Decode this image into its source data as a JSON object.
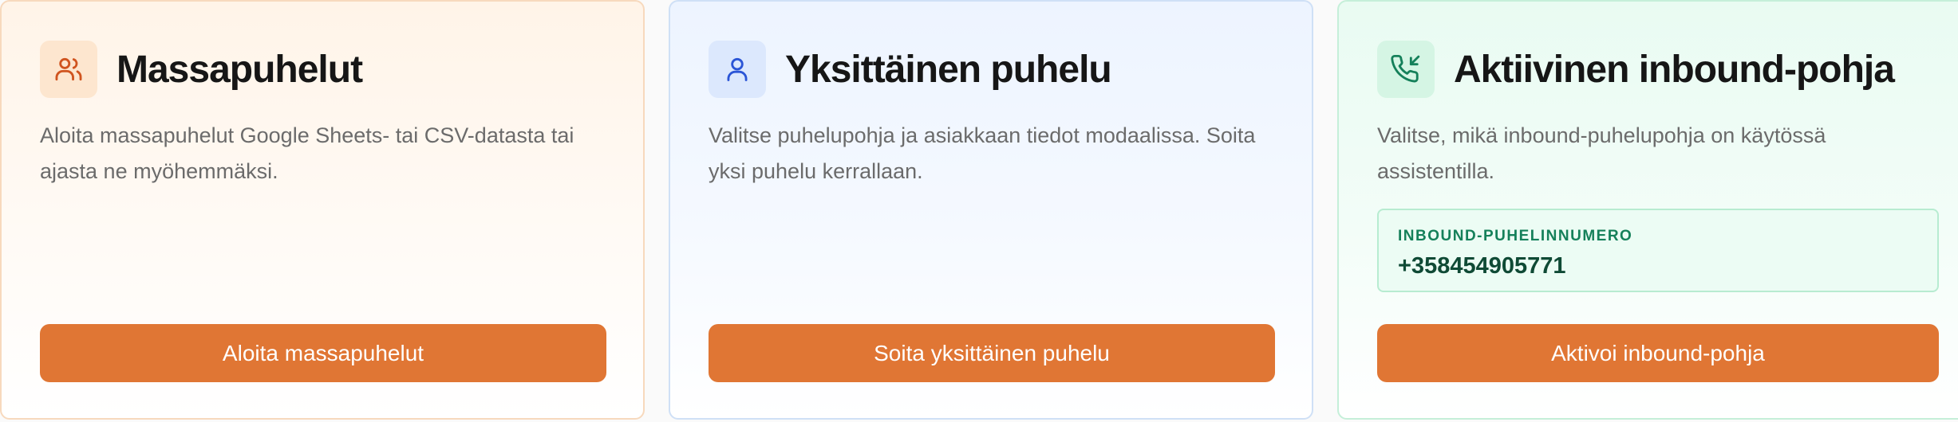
{
  "cards": [
    {
      "icon": "users-icon",
      "icon_color": "#d0541f",
      "icon_bg": "#fde6cf",
      "title": "Massapuhelut",
      "description": "Aloita massapuhelut Google Sheets- tai CSV-datasta tai ajasta ne myöhemmäksi.",
      "button_label": "Aloita massapuhelut"
    },
    {
      "icon": "user-icon",
      "icon_color": "#2b55d6",
      "icon_bg": "#dce8fd",
      "title": "Yksittäinen puhelu",
      "description": "Valitse puhelupohja ja asiakkaan tiedot modaalissa. Soita yksi puhelu kerrallaan.",
      "button_label": "Soita yksittäinen puhelu"
    },
    {
      "icon": "phone-incoming-icon",
      "icon_color": "#15805a",
      "icon_bg": "#d5f5e4",
      "title": "Aktiivinen inbound-pohja",
      "description": "Valitse, mikä inbound-puhelupohja on käytössä assistentilla.",
      "phone_label": "INBOUND-PUHELINNUMERO",
      "phone_number": "+358454905771",
      "button_label": "Aktivoi inbound-pohja"
    }
  ],
  "colors": {
    "button_bg": "#e07634",
    "button_text": "#ffffff"
  }
}
